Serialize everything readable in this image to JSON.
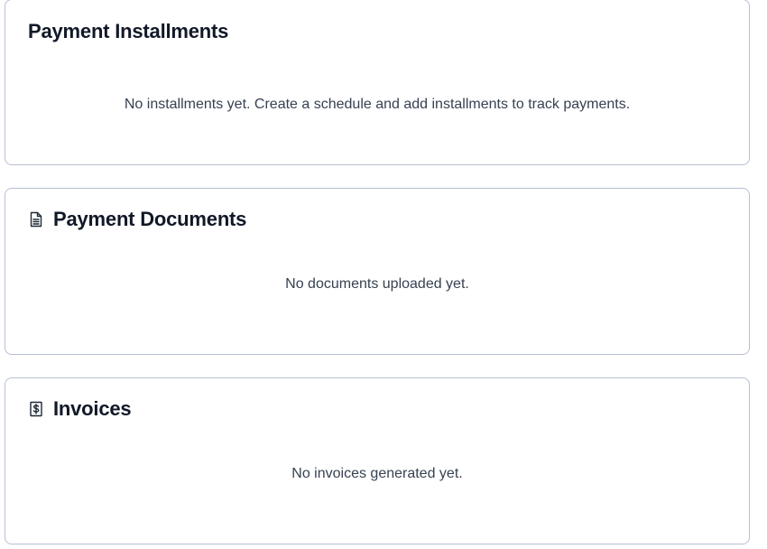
{
  "sections": {
    "installments": {
      "title": "Payment Installments",
      "empty_message": "No installments yet. Create a schedule and add installments to track payments."
    },
    "documents": {
      "title": "Payment Documents",
      "icon": "document-icon",
      "empty_message": "No documents uploaded yet."
    },
    "invoices": {
      "title": "Invoices",
      "icon": "invoice-dollar-icon",
      "empty_message": "No invoices generated yet."
    }
  },
  "colors": {
    "card_border": "#b7bfd3",
    "title_text": "#111827",
    "body_text": "#374151"
  }
}
